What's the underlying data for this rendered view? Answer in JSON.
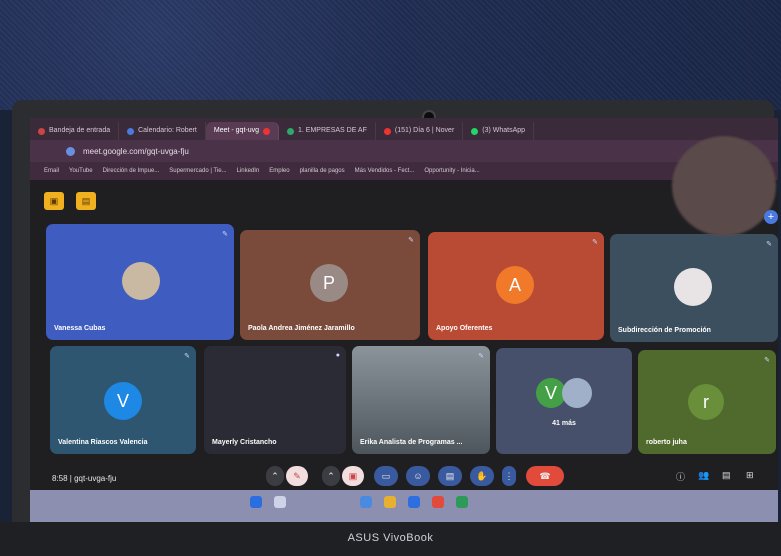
{
  "browser": {
    "tabs": [
      {
        "label": "Bandeja de entrada",
        "color": "#c44"
      },
      {
        "label": "Calendario: Robert",
        "color": "#4a7ae0"
      },
      {
        "label": "Meet - gqt-uvg",
        "color": "#2ea86b"
      },
      {
        "label": "1. EMPRESAS DE AF",
        "color": "#2ea86b"
      },
      {
        "label": "(151) Día 6 | Nover",
        "color": "#e33"
      },
      {
        "label": "(3) WhatsApp",
        "color": "#25d366"
      }
    ],
    "url": "meet.google.com/gqt-uvga-fju",
    "bookmarks": [
      "Email",
      "YouTube",
      "Dirección de Impue...",
      "Supermercado | Tie...",
      "LinkedIn",
      "Empleo",
      "planilla de pagos",
      "Más Vendidos - Fect...",
      "Opportunity - Inicia..."
    ]
  },
  "meeting": {
    "code_time": "8:58 | gqt-uvga-fju",
    "participants": [
      {
        "name": "Vanessa Cubas",
        "initial": "",
        "color": "#3f5cc0"
      },
      {
        "name": "Paola Andrea Jiménez Jaramillo",
        "initial": "P",
        "color": "#7a4a3a"
      },
      {
        "name": "Apoyo Oferentes",
        "initial": "A",
        "color": "#b94a34"
      },
      {
        "name": "Subdirección de Promoción",
        "initial": "",
        "color": "#3c4f5f"
      },
      {
        "name": "Valentina Riascos Valencia",
        "initial": "V",
        "color": "#2e5670"
      },
      {
        "name": "Mayerly Cristancho",
        "initial": "",
        "color": "#2b2b36"
      },
      {
        "name": "Erika Analista de Programas ...",
        "initial": "",
        "color": "#55606a"
      },
      {
        "name": "41 más",
        "initial": "V",
        "color": "#46506a"
      },
      {
        "name": "roberto juha",
        "initial": "r",
        "color": "#4f6a2c"
      }
    ]
  },
  "laptop": {
    "brand": "ASUS VivoBook"
  }
}
